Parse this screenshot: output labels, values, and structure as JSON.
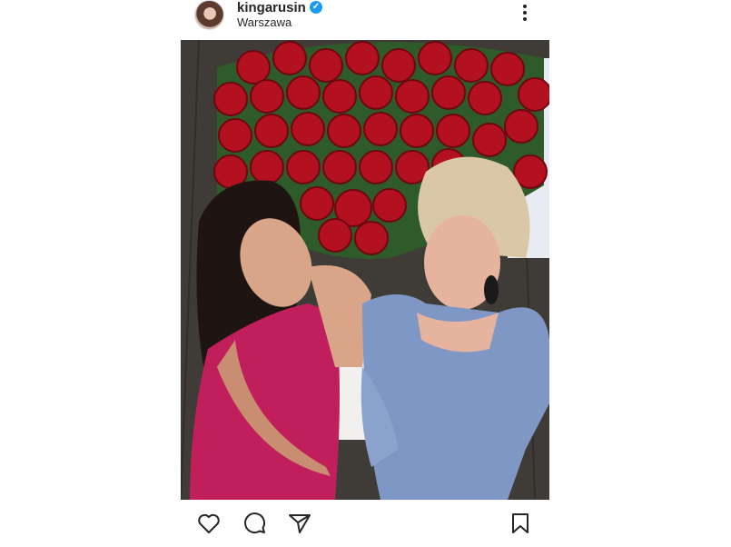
{
  "post": {
    "username": "kingarusin",
    "verified": true,
    "location": "Warszawa"
  },
  "icons": {
    "like": "heart-icon",
    "comment": "comment-icon",
    "share": "send-icon",
    "save": "bookmark-icon",
    "more": "more-vertical-icon"
  },
  "colors": {
    "text": "#262626",
    "verified": "#1d9bf0",
    "roses": "#b3111f"
  }
}
